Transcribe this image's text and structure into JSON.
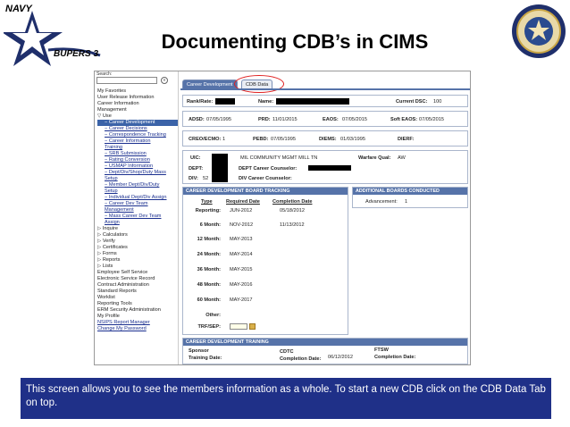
{
  "header": {
    "title": "Documenting CDB’s in CIMS",
    "logo_text_navy": "NAVY",
    "logo_text_bupers": "BUPERS 3",
    "seal_icon": "navy-seal-icon"
  },
  "nav": {
    "menu_label": "Search:",
    "go_label": "»",
    "items": [
      {
        "label": "My Favorites",
        "level": 0,
        "link": false
      },
      {
        "label": "User Release Information",
        "level": 0,
        "link": false
      },
      {
        "label": "Career Information",
        "level": 0,
        "link": false
      },
      {
        "label": "Management",
        "level": 0,
        "link": false
      },
      {
        "label": "▽ Use",
        "level": 0,
        "link": false
      },
      {
        "label": "− Career Development",
        "level": 1,
        "link": false,
        "active": true
      },
      {
        "label": "− Career Decisions",
        "level": 1,
        "link": true
      },
      {
        "label": "− Correspondence Tracking",
        "level": 1,
        "link": true
      },
      {
        "label": "− Career Information",
        "level": 1,
        "link": true
      },
      {
        "label": "Training",
        "level": 1,
        "link": true
      },
      {
        "label": "− SRB Submission",
        "level": 1,
        "link": true
      },
      {
        "label": "− Rating Conversion",
        "level": 1,
        "link": true
      },
      {
        "label": "− USMAP Information",
        "level": 1,
        "link": true
      },
      {
        "label": "− Dept/Div/Shop/Duty Mass",
        "level": 1,
        "link": true
      },
      {
        "label": "Setup",
        "level": 1,
        "link": true
      },
      {
        "label": "− Member Dept/Div/Duty",
        "level": 1,
        "link": true
      },
      {
        "label": "Setup",
        "level": 1,
        "link": true
      },
      {
        "label": "− Individual Dept/Div Assign",
        "level": 1,
        "link": true
      },
      {
        "label": "− Career Dev Team",
        "level": 1,
        "link": true
      },
      {
        "label": "Management",
        "level": 1,
        "link": true
      },
      {
        "label": "− Mass Career Dev Team",
        "level": 1,
        "link": true
      },
      {
        "label": "Assign",
        "level": 1,
        "link": true
      },
      {
        "label": "▷ Inquire",
        "level": 0,
        "link": false
      },
      {
        "label": "▷ Calculators",
        "level": 0,
        "link": false
      },
      {
        "label": "▷ Verify",
        "level": 0,
        "link": false
      },
      {
        "label": "▷ Certificates",
        "level": 0,
        "link": false
      },
      {
        "label": "▷ Forms",
        "level": 0,
        "link": false
      },
      {
        "label": "▷ Reports",
        "level": 0,
        "link": false
      },
      {
        "label": "▷ Lists",
        "level": 0,
        "link": false
      },
      {
        "label": "Employee Self Service",
        "level": 0,
        "link": false
      },
      {
        "label": "Electronic Service Record",
        "level": 0,
        "link": false
      },
      {
        "label": "Contract Administration",
        "level": 0,
        "link": false
      },
      {
        "label": "Standard Reports",
        "level": 0,
        "link": false
      },
      {
        "label": "Worklist",
        "level": 0,
        "link": false
      },
      {
        "label": "Reporting Tools",
        "level": 0,
        "link": false
      },
      {
        "label": "ERM Security Administration",
        "level": 0,
        "link": false
      },
      {
        "label": "My Profile",
        "level": 0,
        "link": false
      },
      {
        "label": "NSIPS Report Manager",
        "level": 0,
        "link": true
      },
      {
        "label": "Change My Password",
        "level": 0,
        "link": true
      }
    ]
  },
  "tabs": {
    "tab1": "Career Development",
    "tab2": "CDB Data"
  },
  "member": {
    "rank_label": "Rank/Rate:",
    "name_label": "Name:",
    "dsc_label": "Current DSC:",
    "dsc_value": "100",
    "adsd_label": "ADSD:",
    "adsd_value": "07/05/1995",
    "prd_label": "PRD:",
    "prd_value": "11/01/2015",
    "eaos_label": "EAOS:",
    "eaos_value": "07/05/2015",
    "softeaos_label": "Soft EAOS:",
    "softeaos_value": "07/05/2015",
    "creo_label": "CREO/ECMO:",
    "creo_value": "1",
    "pebd_label": "PEBD:",
    "pebd_value": "07/05/1995",
    "diems_label": "DIEMS:",
    "diems_value": "01/03/1995",
    "dierf_label": "DIERF:",
    "uic_label": "UIC:",
    "uic_value": "MIL COMMUNITY MGMT MILL TN",
    "warfare_label": "Warfare Qual:",
    "warfare_value": "AW",
    "dept_label": "DEPT:",
    "dept_counselor_label": "DEPT Career Counselor:",
    "div_label": "DIV:",
    "div_value": "52",
    "div_counselor_label": "DIV Career Counselor:"
  },
  "cdb_tracking": {
    "header": "CAREER DEVELOPMENT BOARD TRACKING",
    "col_type": "Type",
    "col_required": "Required Date",
    "col_completion": "Completion Date",
    "rows": [
      {
        "type": "Reporting:",
        "required": "JUN-2012",
        "completion": "05/18/2012"
      },
      {
        "type": "6 Month:",
        "required": "NOV-2012",
        "completion": "11/13/2012"
      },
      {
        "type": "12 Month:",
        "required": "MAY-2013",
        "completion": ""
      },
      {
        "type": "24 Month:",
        "required": "MAY-2014",
        "completion": ""
      },
      {
        "type": "36 Month:",
        "required": "MAY-2015",
        "completion": ""
      },
      {
        "type": "48 Month:",
        "required": "MAY-2016",
        "completion": ""
      },
      {
        "type": "60 Month:",
        "required": "MAY-2017",
        "completion": ""
      },
      {
        "type": "Other:",
        "required": "",
        "completion": ""
      },
      {
        "type": "TRF/SEP:",
        "required": "",
        "completion": ""
      }
    ]
  },
  "additional_boards": {
    "header": "ADDITIONAL BOARDS CONDUCTED",
    "advancement_label": "Advancement:",
    "advancement_value": "1"
  },
  "cdb_training": {
    "header": "CAREER DEVELOPMENT TRAINING",
    "sponsor_label": "Sponsor",
    "sponsor_date_label": "Training Date:",
    "cdtc_label": "CDTC",
    "cdtc_date_label": "Completion Date:",
    "cdtc_date_value": "06/12/2012",
    "ftsw_label": "FTSW",
    "ftsw_date_label": "Completion Date:"
  },
  "caption": "This screen allows you to see the members information as a whole. To start a new CDB click on the CDB Data Tab on top.",
  "colors": {
    "caption_bg": "#1f3088",
    "header_blue": "#5673a9",
    "highlight_circle": "#e02020",
    "star_navy": "#1f2f6b"
  }
}
